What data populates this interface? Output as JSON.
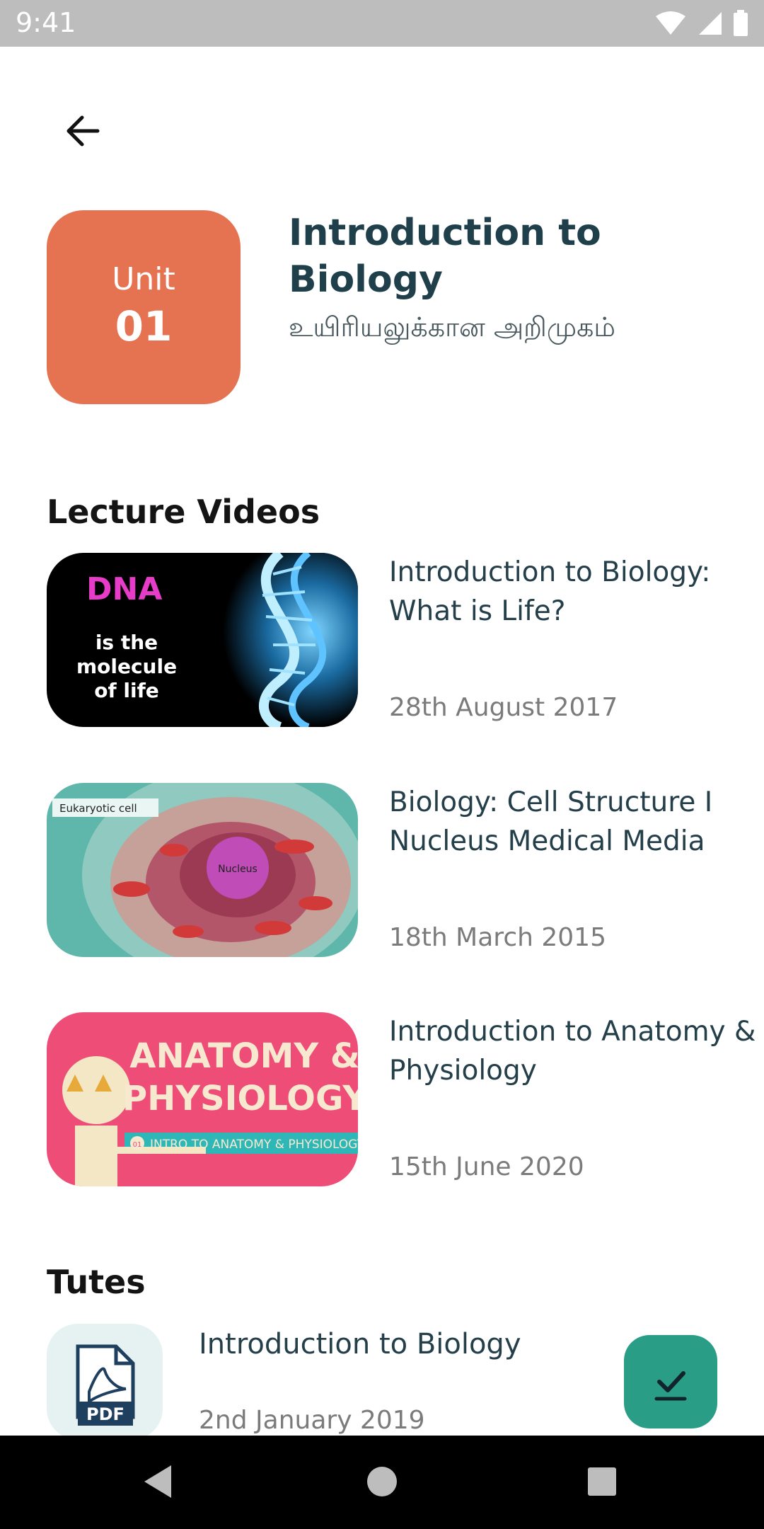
{
  "status": {
    "time": "9:41"
  },
  "header": {
    "back_icon": "arrow-left-icon"
  },
  "unit": {
    "label": "Unit",
    "number": "01",
    "color": "#e57250",
    "title": "Introduction to Biology",
    "subtitle": "உயிரியலுக்கான அறிமுகம்"
  },
  "lecture_videos": {
    "heading": "Lecture Videos",
    "items": [
      {
        "title": "Introduction to Biology: What is Life?",
        "date": "28th August 2017",
        "thumb_text": {
          "line1": "DNA",
          "line2": "is the",
          "line3": "molecule",
          "line4": "of life"
        }
      },
      {
        "title": "Biology: Cell Structure I Nucleus Medical Media",
        "date": "18th March 2015",
        "thumb_text": {
          "tag": "Eukaryotic cell",
          "center": "Nucleus"
        }
      },
      {
        "title": "Introduction to Anatomy & Physiology",
        "date": "15th June 2020",
        "thumb_text": {
          "line1": "ANATOMY &",
          "line2": "PHYSIOLOGY",
          "strip": "INTRO TO ANATOMY & PHYSIOLOGY",
          "badge": "01"
        }
      }
    ]
  },
  "tutes": {
    "heading": "Tutes",
    "items": [
      {
        "title": "Introduction to Biology",
        "date": "2nd January 2019",
        "icon": "pdf-icon",
        "icon_label": "PDF"
      }
    ]
  },
  "fab": {
    "icon": "download-done-icon",
    "color": "#2a9d86"
  },
  "navbar": {
    "icons": [
      "back-triangle-icon",
      "home-circle-icon",
      "recents-square-icon"
    ]
  }
}
